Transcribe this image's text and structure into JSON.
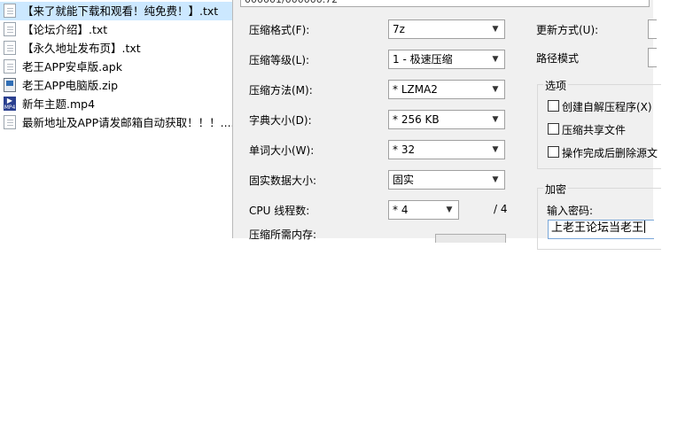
{
  "files": [
    {
      "name": "【来了就能下载和观看！纯免费！】.txt",
      "icon": "text-file-icon",
      "selected": true
    },
    {
      "name": "【论坛介绍】.txt",
      "icon": "text-file-icon",
      "selected": false
    },
    {
      "name": "【永久地址发布页】.txt",
      "icon": "text-file-icon",
      "selected": false
    },
    {
      "name": "老王APP安卓版.apk",
      "icon": "file-icon",
      "selected": false
    },
    {
      "name": "老王APP电脑版.zip",
      "icon": "archive-icon",
      "selected": false
    },
    {
      "name": "新年主题.mp4",
      "icon": "video-file-icon",
      "selected": false
    },
    {
      "name": "最新地址及APP请发邮箱自动获取！！！....",
      "icon": "text-file-icon",
      "selected": false
    }
  ],
  "archive_path": "000001/000000.72",
  "options": {
    "format_label": "压缩格式(F):",
    "format_value": "7z",
    "level_label": "压缩等级(L):",
    "level_value": "1 - 极速压缩",
    "method_label": "压缩方法(M):",
    "method_value": "* LZMA2",
    "dict_label": "字典大小(D):",
    "dict_value": "* 256 KB",
    "word_label": "单词大小(W):",
    "word_value": "* 32",
    "solid_label": "固实数据大小:",
    "solid_value": "固实",
    "cpu_label": "CPU 线程数:",
    "cpu_value": "* 4",
    "cpu_max": "/ 4",
    "memory_label": "压缩所需内存:"
  },
  "right": {
    "update_label": "更新方式(U):",
    "path_label": "路径模式",
    "options_group": "选项",
    "sfx_label": "创建自解压程序(X)",
    "shared_label": "压缩共享文件",
    "delete_label": "操作完成后删除源文",
    "encrypt_group": "加密",
    "password_label": "输入密码:",
    "password_value": "上老王论坛当老王"
  }
}
